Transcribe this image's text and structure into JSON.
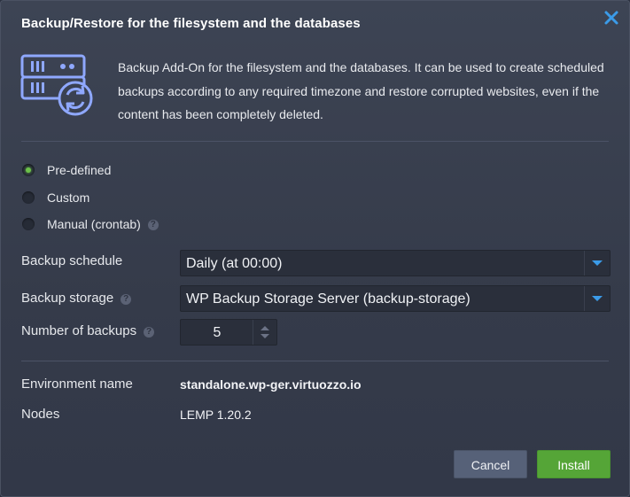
{
  "dialog": {
    "title": "Backup/Restore for the filesystem and the databases",
    "description": "Backup Add-On for the filesystem and the databases. It can be used to create scheduled backups according to any required timezone and restore corrupted websites, even if the content has been completely deleted.",
    "close_icon": "close-icon",
    "header_icon": "server-backup-icon"
  },
  "mode": {
    "options": [
      {
        "label": "Pre-defined",
        "checked": true
      },
      {
        "label": "Custom",
        "checked": false
      },
      {
        "label": "Manual (crontab)",
        "checked": false
      }
    ],
    "help_glyph": "?"
  },
  "form": {
    "schedule_label": "Backup schedule",
    "schedule_value": "Daily (at 00:00)",
    "storage_label": "Backup storage",
    "storage_value": "WP Backup Storage Server (backup-storage)",
    "backups_label": "Number of backups",
    "backups_value": "5"
  },
  "info": {
    "env_label": "Environment name",
    "env_value": "standalone.wp-ger.virtuozzo.io",
    "nodes_label": "Nodes",
    "nodes_value": "LEMP 1.20.2"
  },
  "buttons": {
    "cancel": "Cancel",
    "install": "Install"
  },
  "colors": {
    "accent_green": "#55a537",
    "accent_blue": "#3b9be8",
    "icon_blue": "#8fa8ff"
  }
}
